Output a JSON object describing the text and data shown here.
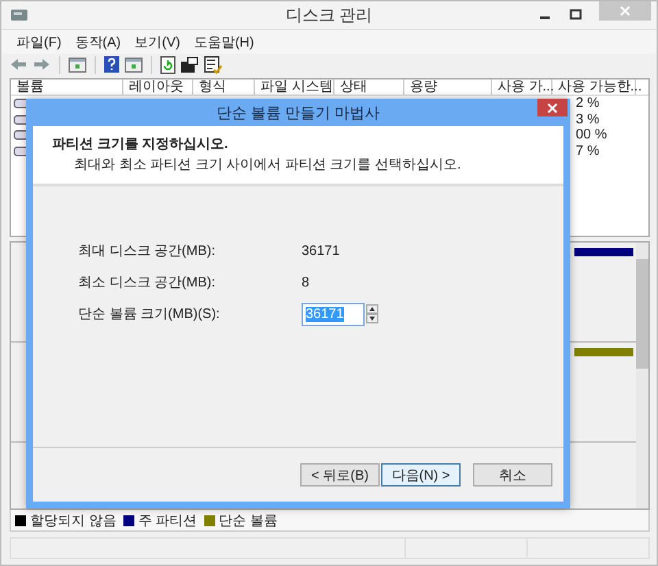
{
  "window": {
    "title": "디스크 관리"
  },
  "menu": [
    "파일(F)",
    "동작(A)",
    "보기(V)",
    "도움말(H)"
  ],
  "table": {
    "columns": [
      "볼륨",
      "레이아웃",
      "형식",
      "파일 시스템",
      "상태",
      "용량",
      "사용 가...",
      "사용 가능한..."
    ],
    "rows": [
      {
        "column_8": "2 %"
      },
      {
        "column_8": "3 %"
      },
      {
        "column_8": "00 %"
      },
      {
        "column_8": "7 %"
      }
    ]
  },
  "disk_bars": [
    {
      "color": "#000080"
    },
    {
      "color": "#808000"
    }
  ],
  "legend": [
    {
      "label": "할당되지 않음",
      "color": "#000000"
    },
    {
      "label": "주 파티션",
      "color": "#000080"
    },
    {
      "label": "단순 볼륨",
      "color": "#808000"
    }
  ],
  "dialog": {
    "title": "단순 볼륨 만들기 마법사",
    "heading": "파티션 크기를 지정하십시오.",
    "subheading": "최대와 최소 파티션 크기 사이에서 파티션 크기를 선택하십시오.",
    "fields": [
      {
        "kind": "text",
        "label": "최대 디스크 공간(MB):",
        "value": "36171"
      },
      {
        "kind": "text",
        "label": "최소 디스크 공간(MB):",
        "value": "8"
      },
      {
        "kind": "spinner",
        "label": "단순 볼륨 크기(MB)(S):",
        "value": "36171"
      }
    ],
    "buttons": [
      {
        "label": "< 뒤로(B)",
        "default": false
      },
      {
        "label": "다음(N) >",
        "default": true
      },
      {
        "label": "취소",
        "default": false
      }
    ]
  }
}
